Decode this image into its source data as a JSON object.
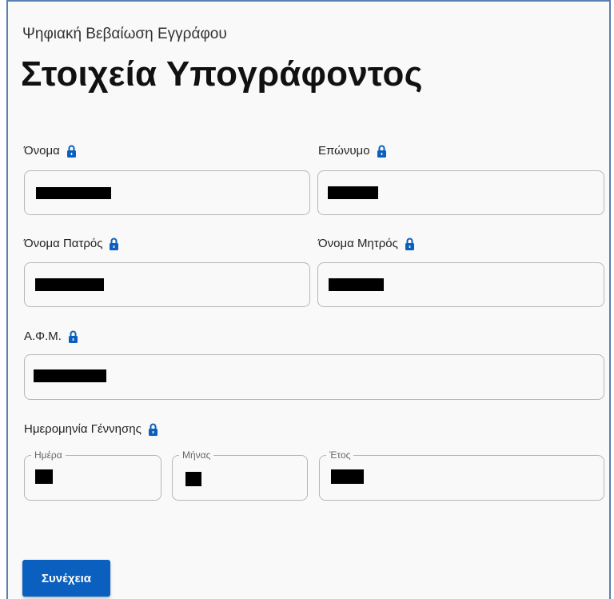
{
  "header": {
    "subtitle": "Ψηφιακή Βεβαίωση Εγγράφου",
    "title": "Στοιχεία Υπογράφοντος"
  },
  "fields": {
    "first_name": {
      "label": "Όνομα"
    },
    "last_name": {
      "label": "Επώνυμο"
    },
    "father_name": {
      "label": "Όνομα Πατρός"
    },
    "mother_name": {
      "label": "Όνομα Μητρός"
    },
    "afm": {
      "label": "Α.Φ.Μ."
    },
    "birth_date": {
      "label": "Ημερομηνία Γέννησης",
      "day_label": "Ημέρα",
      "month_label": "Μήνας",
      "year_label": "Έτος"
    }
  },
  "actions": {
    "continue_label": "Συνέχεια"
  },
  "colors": {
    "accent": "#0b5fbe",
    "lock": "#0b5fbe",
    "card_border": "#5b7fb1"
  },
  "icons": {
    "field_lock": "lock-icon"
  }
}
